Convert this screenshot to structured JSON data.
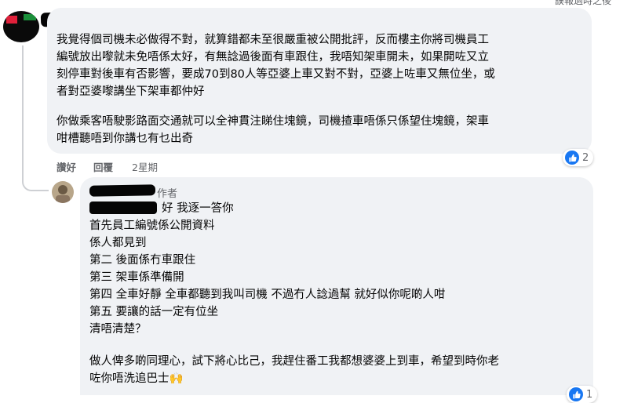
{
  "top_clip_text": "誤報過時之後",
  "comment1": {
    "paragraph1": [
      "我覺得個司機未必做得不對，就算錯都未至很嚴重被公開批評，反而樓主你將司機員工",
      "編號放出嚟就未免唔係太好，有無諗過後面有車跟住，我唔知架車開未，如果開咗又立",
      "刻停車對後車有否影響，要成70到80人等亞婆上車又對不對，亞婆上咗車又無位坐，或",
      "者對亞婆嚟講坐下架車都仲好"
    ],
    "paragraph2": [
      "你做乘客唔駛影路面交通就可以全神貫注睇住塊鏡，司機揸車唔係只係望住塊鏡，架車",
      "咁槽聽唔到你講乜有乜出奇"
    ],
    "actions": {
      "like": "讚好",
      "reply": "回覆",
      "timestamp": "2星期"
    },
    "reaction_count": "2"
  },
  "comment2": {
    "author_badge": "作者",
    "lines": [
      "好 我逐一答你",
      "首先員工編號係公開資料",
      "係人都見到",
      "第二 後面係冇車跟住",
      "第三 架車係準備開",
      "第四 全車好靜 全車都聽到我叫司機 不過冇人諗過幫 就好似你呢啲人咁",
      "第五 要讓的話一定有位坐",
      "清唔清楚？"
    ],
    "final_paragraph": [
      "做人俾多啲同理心，試下將心比己，我趕住番工我都想婆婆上到車，希望到時你老",
      "咗你唔洗追巴士🙌"
    ],
    "reaction_count": "1"
  },
  "colors": {
    "bubble": "#f0f2f5",
    "like_blue": "#1877f2",
    "meta_gray": "#65676b",
    "text": "#050505"
  },
  "icons": {
    "reaction": "like-thumb-icon",
    "clap": "raising-hands-emoji"
  }
}
